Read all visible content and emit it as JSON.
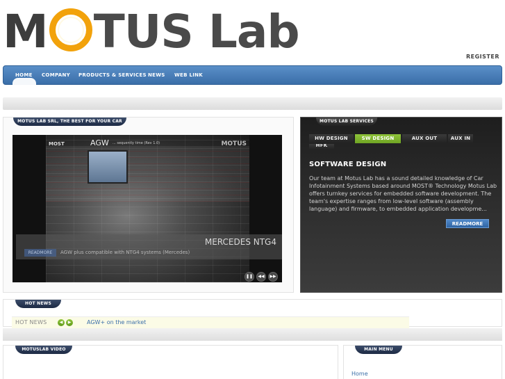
{
  "logo": {
    "part1": "M",
    "part2": "TUS Lab"
  },
  "header": {
    "register": "REGISTER"
  },
  "nav": {
    "items": [
      "HOME",
      "COMPANY",
      "PRODUCTS & SERVICES",
      "NEWS",
      "WEB LINK"
    ],
    "active": "HOME"
  },
  "left_panel": {
    "label": "MOTUS LAB SRL, THE BEST FOR YOUR CAR",
    "video": {
      "header_brand": "MOST",
      "header_agw": "AGW",
      "header_note": "... sequently time (Rev 1.0)",
      "header_logo": "MOTUS",
      "caption_title": "MERCEDES NTG4",
      "readmore": "READMORE",
      "caption_text": "AGW plus compatible with NTG4 systems (Mercedes)",
      "controls": [
        "❚❚",
        "◀◀",
        "▶▶"
      ]
    }
  },
  "right_panel": {
    "label": "MOTUS LAB SERVICES",
    "tabs": [
      "HW DESIGN",
      "SW DESIGN",
      "AUX OUT",
      "AUX IN",
      "HFK"
    ],
    "active_tab": "SW DESIGN",
    "title": "SOFTWARE DESIGN",
    "body": "Our team at Motus Lab has a sound detailed knowledge of Car Infotainment Systems based around MOST® Technology Motus Lab offers turnkey services for embedded software development. The team's expertise ranges from low-level software (assembly language) and firmware, to embedded application developme...",
    "readmore": "READMORE"
  },
  "hot_news": {
    "label": "HOT NEWS",
    "bar_label": "HOT NEWS",
    "prev_icon": "◀",
    "next_icon": "▶",
    "text": "AGW+ on the market"
  },
  "bottom": {
    "video_label": "MOTUSLAB VIDEO",
    "menu_label": "MAIN MENU",
    "menu_items": [
      "Home"
    ]
  },
  "colors": {
    "nav_blue": "#3a6ea8",
    "accent_green": "#7ab32e",
    "logo_orange": "#f2a20b"
  }
}
